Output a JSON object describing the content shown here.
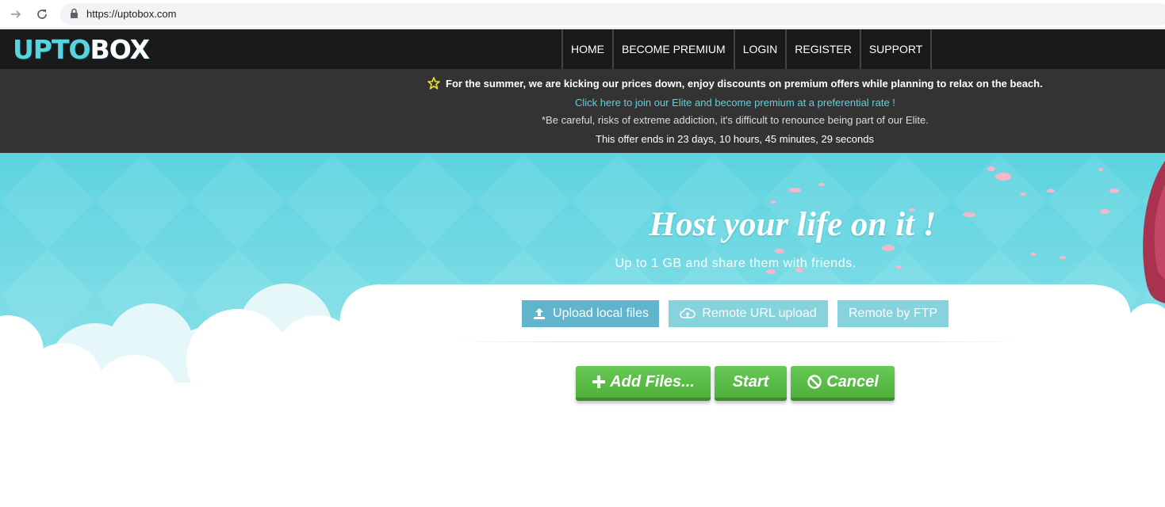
{
  "browser": {
    "url": "https://uptobox.com",
    "back_icon": "arrow-right-icon",
    "reload_icon": "reload-icon"
  },
  "header": {
    "logo_part1": "UPTO",
    "logo_part2": "BOX",
    "nav": [
      "HOME",
      "BECOME PREMIUM",
      "LOGIN",
      "REGISTER",
      "SUPPORT"
    ]
  },
  "promo": {
    "headline": "For the summer, we are kicking our prices down, enjoy discounts on premium offers while planning to relax on the beach.",
    "link": "Click here to join our Elite and become premium at a preferential rate !",
    "warning": "*Be careful, risks of extreme addiction, it's difficult to renounce being part of our Elite.",
    "timer": "This offer ends in 23 days, 10 hours, 45 minutes, 29 seconds"
  },
  "hero": {
    "title": "Host your life on it !",
    "subtitle": "Up to 1 GB and share them with friends."
  },
  "tabs": {
    "local": "Upload local files",
    "remote": "Remote URL upload",
    "ftp": "Remote by FTP"
  },
  "actions": {
    "add": "Add Files...",
    "start": "Start",
    "cancel": "Cancel"
  },
  "colors": {
    "brand": "#5ad3df",
    "header_bg": "#1a1a1a",
    "promo_bg": "#333333",
    "hero_sky": "#5fd4e0",
    "button_green": "#5cbd49"
  }
}
